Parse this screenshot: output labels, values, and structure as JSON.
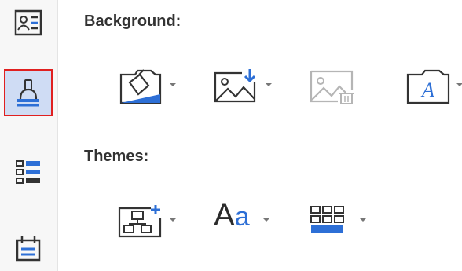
{
  "sidebar": {
    "items": [
      {
        "icon": "contact-card-icon",
        "selected": false
      },
      {
        "icon": "paint-brush-icon",
        "selected": true
      },
      {
        "icon": "list-view-icon",
        "selected": false
      },
      {
        "icon": "calendar-icon",
        "selected": false
      }
    ]
  },
  "background": {
    "title": "Background:",
    "tools": [
      {
        "icon": "fill-color-icon"
      },
      {
        "icon": "insert-picture-icon"
      },
      {
        "icon": "delete-picture-icon",
        "disabled": true
      },
      {
        "icon": "text-watermark-icon",
        "glyph": "A"
      }
    ]
  },
  "themes": {
    "title": "Themes:",
    "tools": [
      {
        "icon": "add-layout-icon"
      },
      {
        "icon": "font-style-icon",
        "label_big": "A",
        "label_small": "a"
      },
      {
        "icon": "color-grid-icon"
      }
    ]
  },
  "colors": {
    "accent": "#2d6fd6",
    "selection_border": "#e02020",
    "selection_fill": "#cfdcf4",
    "icon_stroke": "#333333",
    "disabled": "#b5b5b5"
  }
}
